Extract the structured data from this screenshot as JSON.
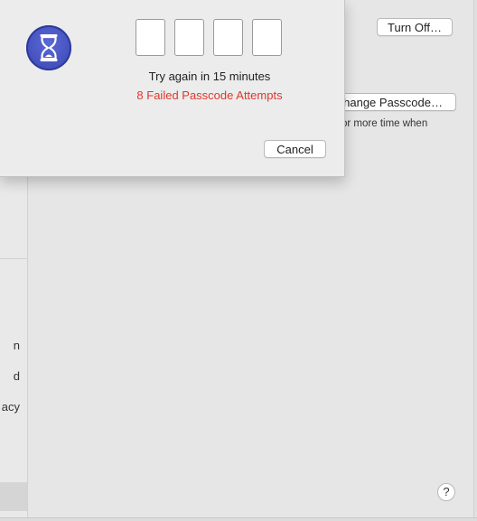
{
  "background": {
    "sidebar_fragments": [
      "n",
      "d",
      "acy"
    ],
    "turn_off_label": "Turn Off…",
    "change_passcode_label": "Change Passcode…",
    "hint_text": "or more time when",
    "help_label": "?"
  },
  "dialog": {
    "icon": "hourglass-icon",
    "digit_count": 4,
    "try_again_text": "Try again in 15 minutes",
    "failed_text": "8 Failed Passcode Attempts",
    "cancel_label": "Cancel"
  },
  "colors": {
    "error": "#e0362c",
    "icon_blue": "#4452c4"
  }
}
